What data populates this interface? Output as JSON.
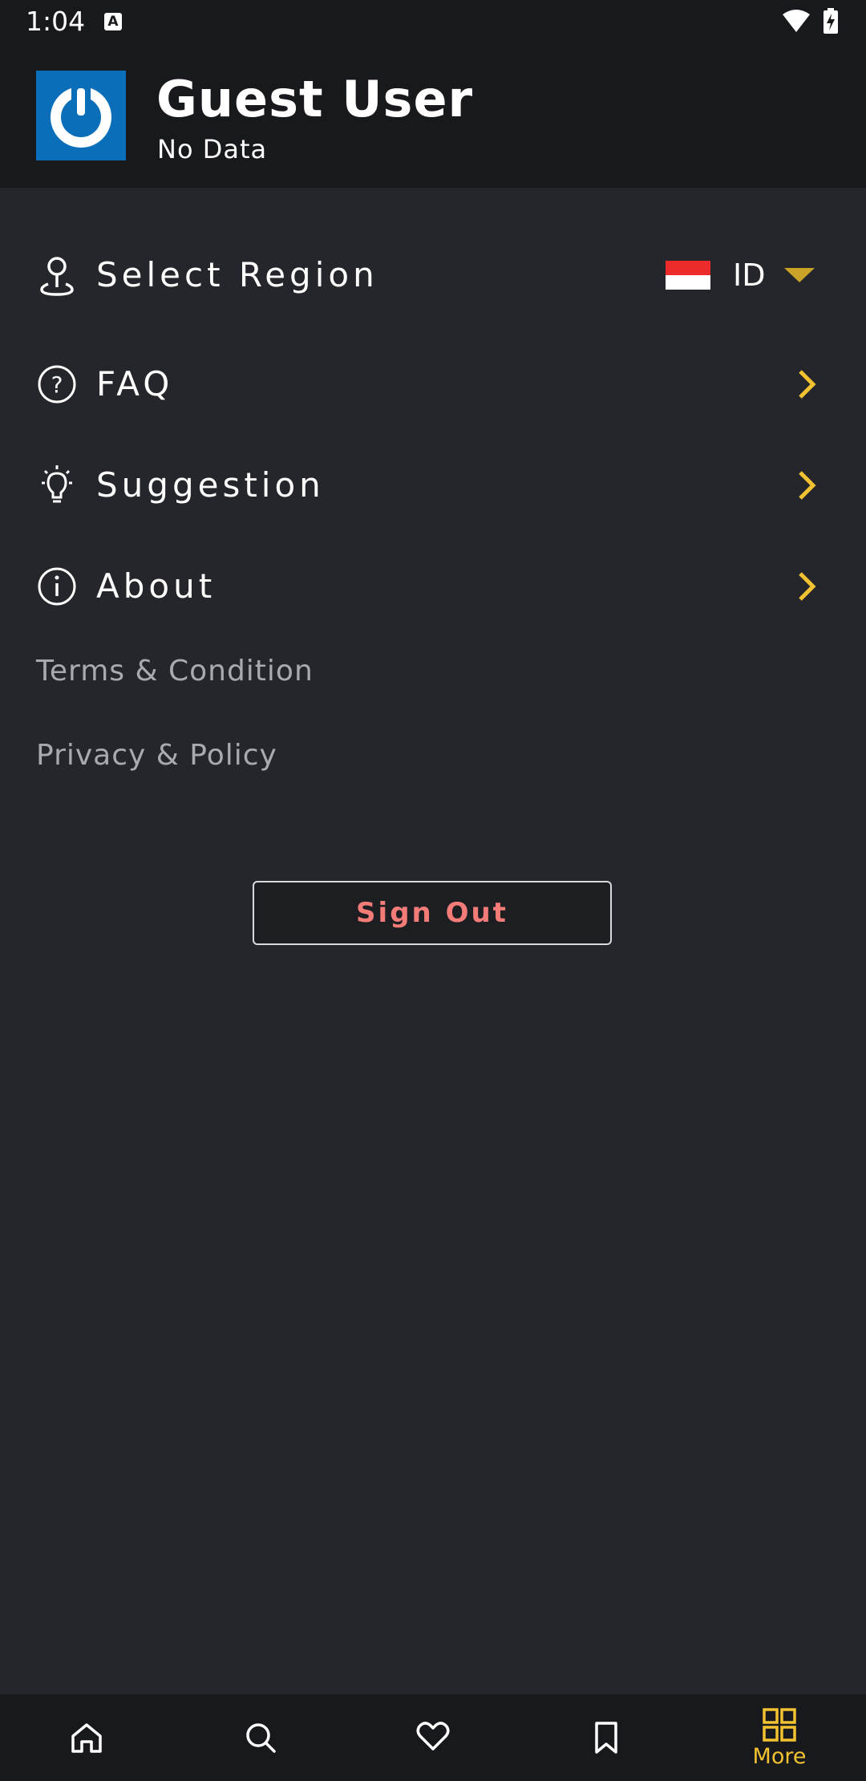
{
  "status_bar": {
    "time": "1:04",
    "notification_icon": "A"
  },
  "header": {
    "user_name": "Guest User",
    "user_subtitle": "No Data",
    "logo_icon": "power-logo-icon"
  },
  "menu": {
    "region": {
      "label": "Select Region",
      "icon": "location-pin-icon",
      "selected_code": "ID",
      "flag_colors": [
        "#ee2b2b",
        "#ffffff"
      ]
    },
    "items": [
      {
        "label": "FAQ",
        "icon": "question-circle-icon"
      },
      {
        "label": "Suggestion",
        "icon": "lightbulb-icon"
      },
      {
        "label": "About",
        "icon": "info-circle-icon"
      }
    ],
    "links": [
      {
        "label": "Terms & Condition"
      },
      {
        "label": "Privacy & Policy"
      }
    ]
  },
  "sign_out": {
    "label": "Sign Out"
  },
  "bottom_nav": {
    "items": [
      {
        "icon": "home-icon"
      },
      {
        "icon": "search-icon"
      },
      {
        "icon": "heart-icon"
      },
      {
        "icon": "bookmark-icon"
      },
      {
        "icon": "grid-icon",
        "label": "More",
        "active": true
      }
    ]
  },
  "colors": {
    "accent": "#f2c231",
    "background": "#25262b",
    "header": "#18191c",
    "sign_out_text": "#f47c78",
    "logo_blue": "#0a6fb8"
  }
}
